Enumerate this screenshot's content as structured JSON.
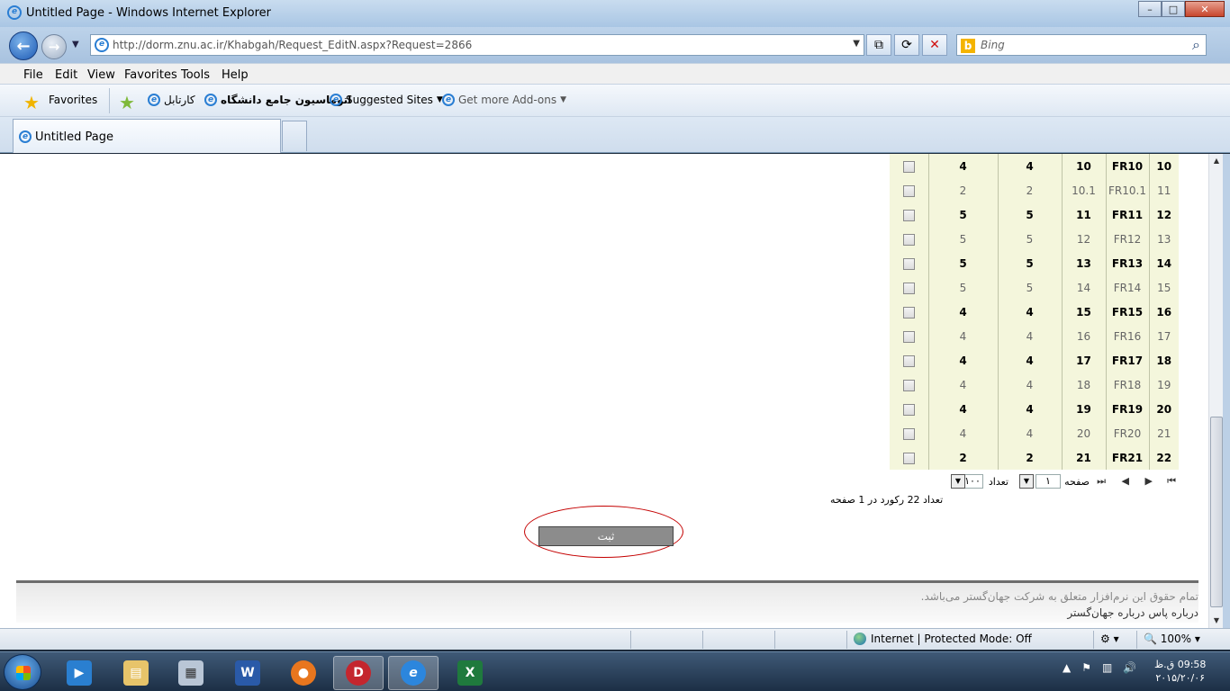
{
  "window": {
    "title": "Untitled Page - Windows Internet Explorer",
    "min": "–",
    "max": "□",
    "close": "✕"
  },
  "nav": {
    "url": "http://dorm.znu.ac.ir/Khabgah/Request_EditN.aspx?Request=2866",
    "search_placeholder": "Bing"
  },
  "menu": [
    "File",
    "Edit",
    "View",
    "Favorites",
    "Tools",
    "Help"
  ],
  "favorites": {
    "label": "Favorites",
    "items": [
      "کارتابل",
      "اتوماسیون جامع دانشگاه",
      "Suggested Sites",
      "Get more Add-ons"
    ]
  },
  "tab": {
    "label": "Untitled Page"
  },
  "grid": {
    "rows": [
      {
        "id": "10",
        "code": "FR10",
        "num": "10",
        "a": "4",
        "b": "4",
        "style": "b"
      },
      {
        "id": "11",
        "code": "FR10.1",
        "num": "10.1",
        "a": "2",
        "b": "2",
        "style": "g"
      },
      {
        "id": "12",
        "code": "FR11",
        "num": "11",
        "a": "5",
        "b": "5",
        "style": "b"
      },
      {
        "id": "13",
        "code": "FR12",
        "num": "12",
        "a": "5",
        "b": "5",
        "style": "g"
      },
      {
        "id": "14",
        "code": "FR13",
        "num": "13",
        "a": "5",
        "b": "5",
        "style": "b"
      },
      {
        "id": "15",
        "code": "FR14",
        "num": "14",
        "a": "5",
        "b": "5",
        "style": "g"
      },
      {
        "id": "16",
        "code": "FR15",
        "num": "15",
        "a": "4",
        "b": "4",
        "style": "b"
      },
      {
        "id": "17",
        "code": "FR16",
        "num": "16",
        "a": "4",
        "b": "4",
        "style": "g"
      },
      {
        "id": "18",
        "code": "FR17",
        "num": "17",
        "a": "4",
        "b": "4",
        "style": "b"
      },
      {
        "id": "19",
        "code": "FR18",
        "num": "18",
        "a": "4",
        "b": "4",
        "style": "g"
      },
      {
        "id": "20",
        "code": "FR19",
        "num": "19",
        "a": "4",
        "b": "4",
        "style": "b"
      },
      {
        "id": "21",
        "code": "FR20",
        "num": "20",
        "a": "4",
        "b": "4",
        "style": "g"
      },
      {
        "id": "22",
        "code": "FR21",
        "num": "21",
        "a": "2",
        "b": "2",
        "style": "b"
      }
    ]
  },
  "pager": {
    "page_label": "صفحه",
    "page_value": "۱",
    "count_label": "تعداد",
    "count_value": "۱۰۰",
    "summary": "تعداد 22 رکورد در 1 صفحه"
  },
  "submit_label": "ثبت",
  "footer": {
    "copyright": "تمام حقوق این نرم‌افزار متعلق به شرکت جهان‌گستر می‌باشد.",
    "links": "درباره پاس  درباره جهان‌گستر"
  },
  "status": {
    "zone": "Internet | Protected Mode: Off",
    "zoom": "100%"
  },
  "clock": {
    "time": "09:58 ق.ظ",
    "date": "۲۰۱۵/۲۰/۰۶"
  }
}
